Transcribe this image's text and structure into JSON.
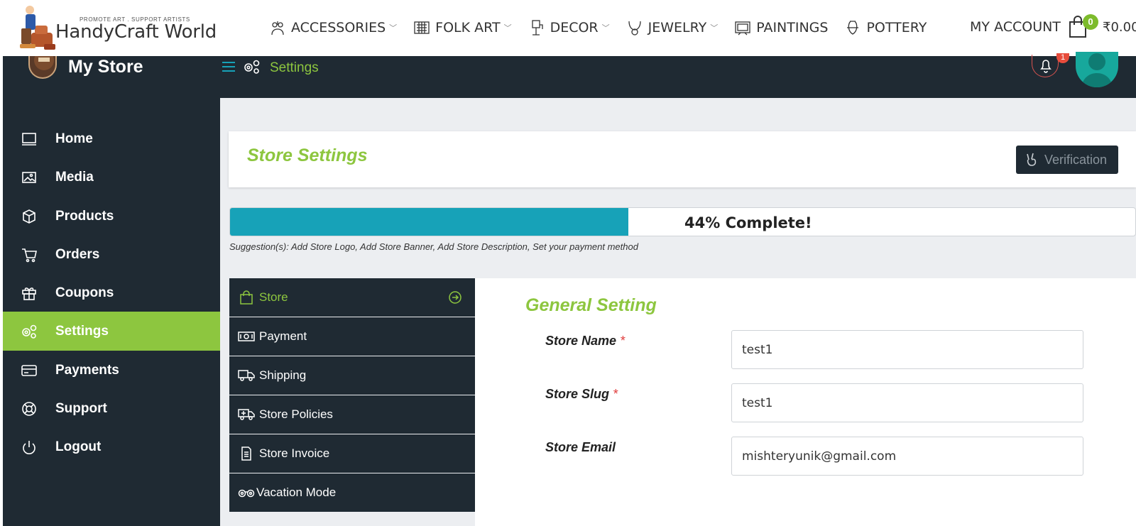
{
  "site": {
    "tagline": "PROMOTE ART . SUPPORT ARTISTS",
    "name": "HandyCraft World"
  },
  "nav": {
    "items": [
      {
        "label": "ACCESSORIES",
        "icon": "accessories-icon",
        "has_dropdown": true
      },
      {
        "label": "FOLK ART",
        "icon": "folk-art-icon",
        "has_dropdown": true
      },
      {
        "label": "DECOR",
        "icon": "decor-icon",
        "has_dropdown": true
      },
      {
        "label": "JEWELRY",
        "icon": "jewelry-icon",
        "has_dropdown": true
      },
      {
        "label": "PAINTINGS",
        "icon": "paintings-icon",
        "has_dropdown": false
      },
      {
        "label": "POTTERY",
        "icon": "pottery-icon",
        "has_dropdown": false
      }
    ],
    "account_label": "MY ACCOUNT",
    "cart_count": "0",
    "cart_total": "₹0.00"
  },
  "dashboard": {
    "store_label": "My Store",
    "breadcrumb": "Settings",
    "notification_count": "1"
  },
  "sidebar": {
    "items": [
      {
        "label": "Home",
        "icon": "monitor-icon"
      },
      {
        "label": "Media",
        "icon": "image-icon"
      },
      {
        "label": "Products",
        "icon": "cube-icon"
      },
      {
        "label": "Orders",
        "icon": "cart-icon"
      },
      {
        "label": "Coupons",
        "icon": "gift-icon"
      },
      {
        "label": "Settings",
        "icon": "gears-icon",
        "active": true
      },
      {
        "label": "Payments",
        "icon": "credit-card-icon"
      },
      {
        "label": "Support",
        "icon": "lifebuoy-icon"
      },
      {
        "label": "Logout",
        "icon": "power-icon"
      }
    ]
  },
  "settings": {
    "title": "Store Settings",
    "verification_label": "Verification",
    "progress_percent": 44,
    "progress_label": "44% Complete!",
    "suggestion": "Suggestion(s): Add Store Logo, Add Store Banner, Add Store Description, Set your payment method"
  },
  "tabs": [
    {
      "label": "Store",
      "icon": "shopping-bag-icon",
      "active": true
    },
    {
      "label": "Payment",
      "icon": "money-icon"
    },
    {
      "label": "Shipping",
      "icon": "truck-icon"
    },
    {
      "label": "Store Policies",
      "icon": "ambulance-icon"
    },
    {
      "label": "Store Invoice",
      "icon": "invoice-icon"
    },
    {
      "label": "Vacation Mode",
      "icon": "binoculars-icon"
    }
  ],
  "general": {
    "title": "General Setting",
    "fields": [
      {
        "label": "Store Name",
        "required": true,
        "value": "test1"
      },
      {
        "label": "Store Slug",
        "required": true,
        "value": "test1"
      },
      {
        "label": "Store Email",
        "required": false,
        "value": "mishteryunik@gmail.com"
      }
    ]
  },
  "colors": {
    "accent_green": "#8dc63f",
    "dark_navy": "#1f2a33",
    "progress_teal": "#17a2b8",
    "required_red": "#e03c3c"
  }
}
